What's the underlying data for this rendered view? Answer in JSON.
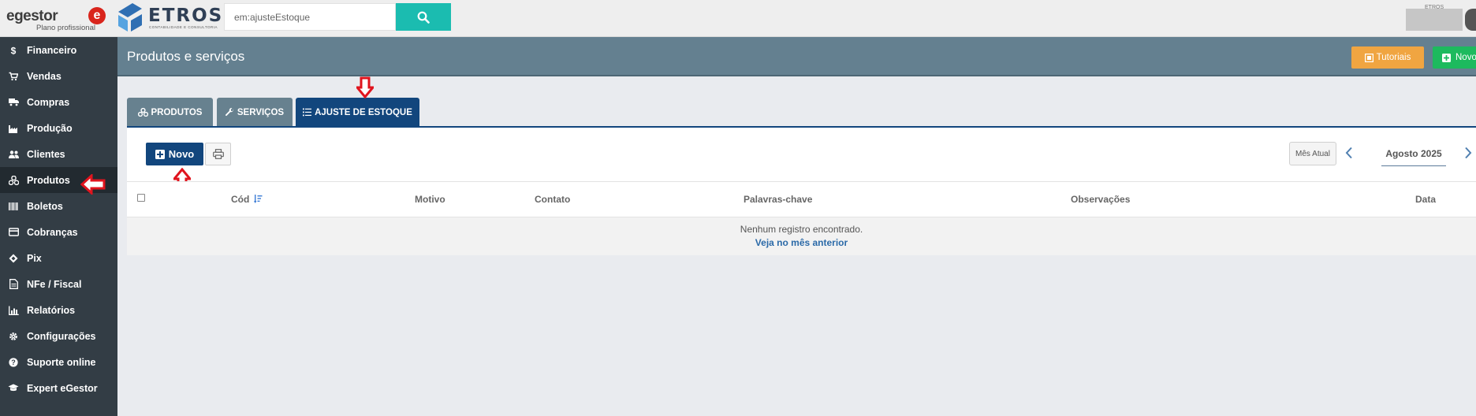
{
  "topbar": {
    "logo_word": "egestor",
    "logo_badge": "e",
    "plan_label": "Plano profissional",
    "partner_logo_word": "ETROS",
    "partner_logo_sub": "CONTABILIDADE E CONSULTORIA",
    "search_value": "em:ajusteEstoque",
    "avatar_text": "ETROS"
  },
  "sidebar": {
    "items": [
      {
        "label": "Financeiro",
        "icon": "dollar-icon"
      },
      {
        "label": "Vendas",
        "icon": "cart-icon"
      },
      {
        "label": "Compras",
        "icon": "truck-icon"
      },
      {
        "label": "Produção",
        "icon": "industry-icon"
      },
      {
        "label": "Clientes",
        "icon": "users-icon"
      },
      {
        "label": "Produtos",
        "icon": "cubes-icon"
      },
      {
        "label": "Boletos",
        "icon": "barcode-icon"
      },
      {
        "label": "Cobranças",
        "icon": "card-icon"
      },
      {
        "label": "Pix",
        "icon": "pix-icon"
      },
      {
        "label": "NFe / Fiscal",
        "icon": "document-icon"
      },
      {
        "label": "Relatórios",
        "icon": "chart-icon"
      },
      {
        "label": "Configurações",
        "icon": "gear-icon"
      },
      {
        "label": "Suporte online",
        "icon": "question-icon"
      },
      {
        "label": "Expert eGestor",
        "icon": "graduation-cap-icon"
      }
    ],
    "active_index": 5
  },
  "header": {
    "title": "Produtos e serviços",
    "tutoriais_label": "Tutoriais",
    "novo_label": "Novo"
  },
  "tabs": [
    {
      "label": "PRODUTOS"
    },
    {
      "label": "SERVIÇOS"
    },
    {
      "label": "AJUSTE DE ESTOQUE"
    }
  ],
  "toolbar": {
    "novo_label": "Novo",
    "mes_atual_label": "Mês Atual",
    "month": "Agosto 2025"
  },
  "table": {
    "columns": [
      "Cód",
      "Motivo",
      "Contato",
      "Palavras-chave",
      "Observações",
      "Data"
    ],
    "empty_message": "Nenhum registro encontrado.",
    "empty_link": "Veja no mês anterior"
  },
  "colors": {
    "sidebar_bg": "#333d45",
    "header_bg": "#648090",
    "tab_active": "#12467d",
    "accent_teal": "#1bbcb0",
    "tutoriais": "#f0a541",
    "novo_green": "#1dba5e",
    "annotation_red": "#e0141e"
  }
}
